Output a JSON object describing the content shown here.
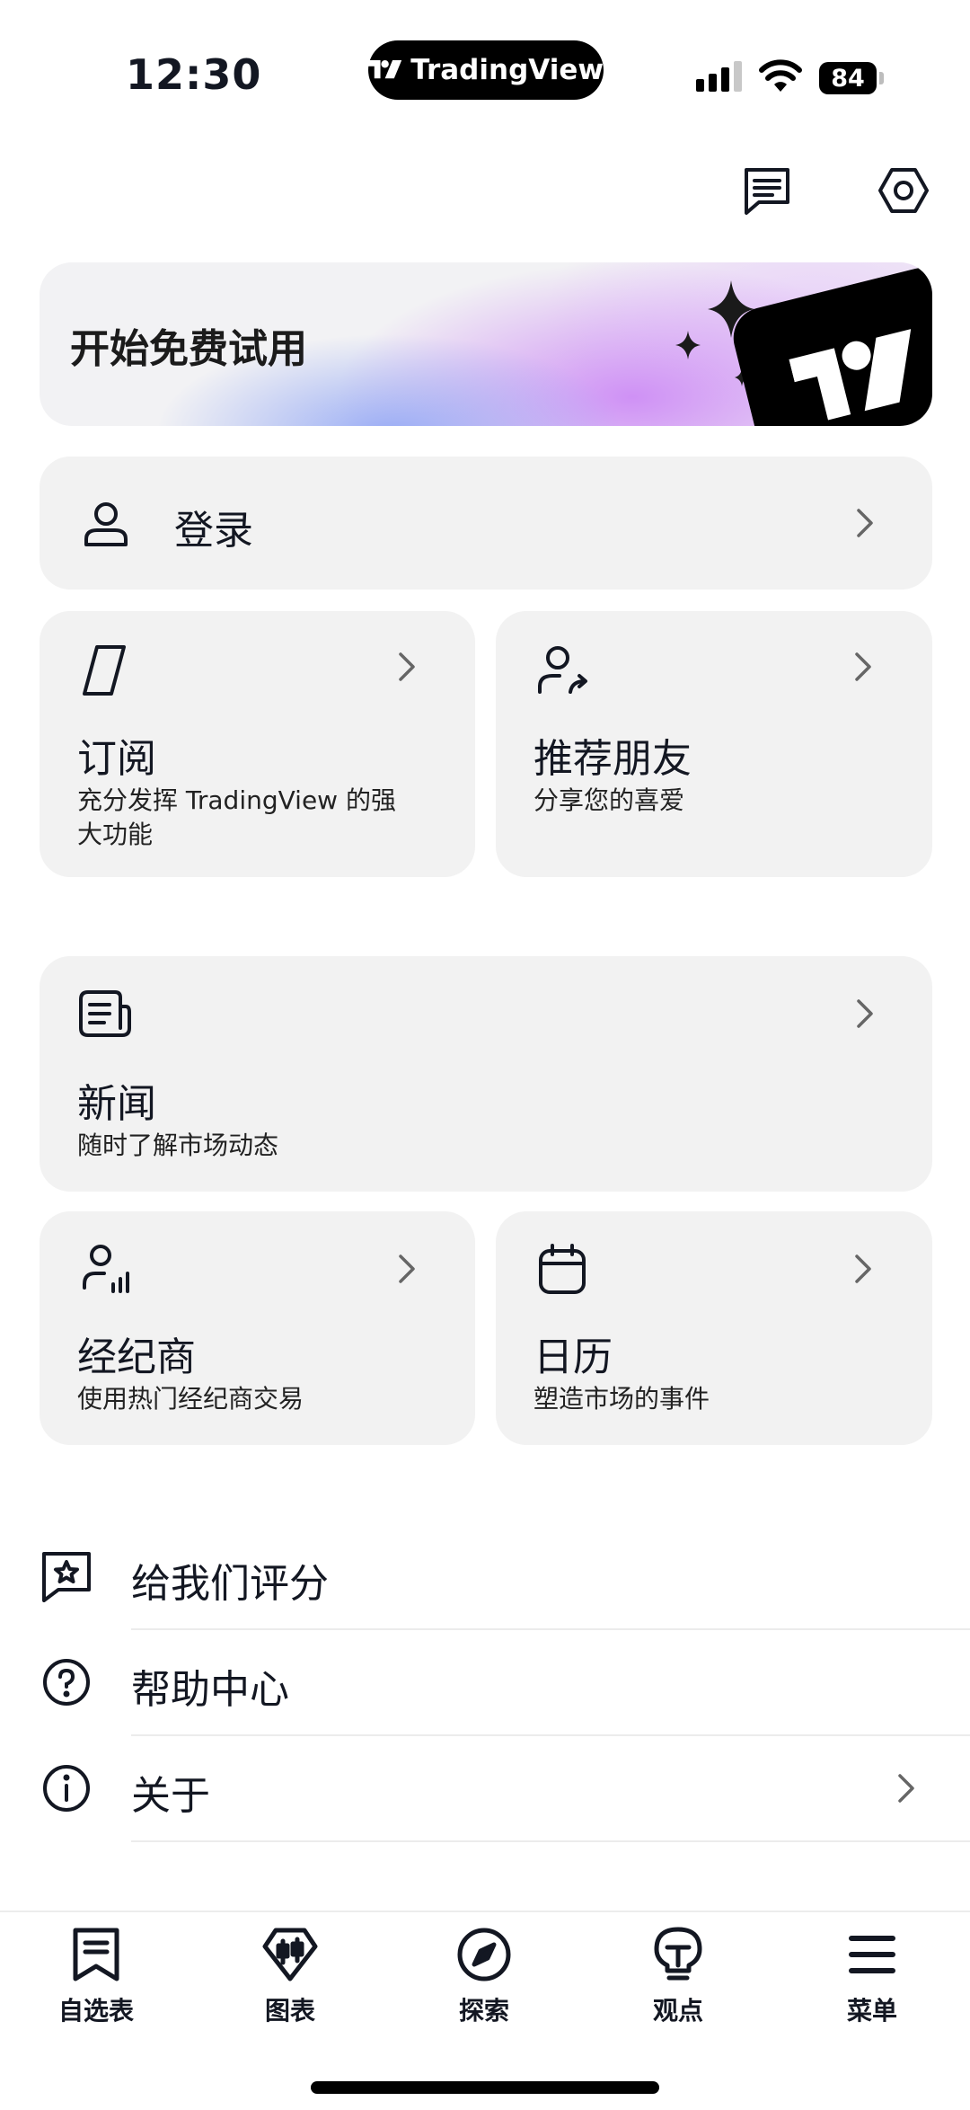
{
  "status_bar": {
    "time": "12:30",
    "app_pill": "TradingView",
    "battery": "84"
  },
  "header": {
    "icons": [
      "chat-icon",
      "settings-icon"
    ]
  },
  "promo": {
    "title": "开始免费试用"
  },
  "login": {
    "label": "登录"
  },
  "cards": {
    "subscribe": {
      "title": "订阅",
      "subtitle_line1": "充分发挥 TradingView 的强",
      "subtitle_line2": "大功能"
    },
    "refer": {
      "title": "推荐朋友",
      "subtitle": "分享您的喜爱"
    },
    "news": {
      "title": "新闻",
      "subtitle": "随时了解市场动态"
    },
    "brokers": {
      "title": "经纪商",
      "subtitle": "使用热门经纪商交易"
    },
    "calendar": {
      "title": "日历",
      "subtitle": "塑造市场的事件"
    }
  },
  "list": {
    "rate": "给我们评分",
    "help": "帮助中心",
    "about": "关于"
  },
  "nav": {
    "watchlist": "自选表",
    "chart": "图表",
    "explore": "探索",
    "ideas": "观点",
    "menu": "菜单"
  },
  "colors": {
    "card_bg": "#f2f2f2",
    "text": "#131722",
    "promo_purple": "#cd8cf5",
    "promo_blue": "#96aaf5"
  }
}
